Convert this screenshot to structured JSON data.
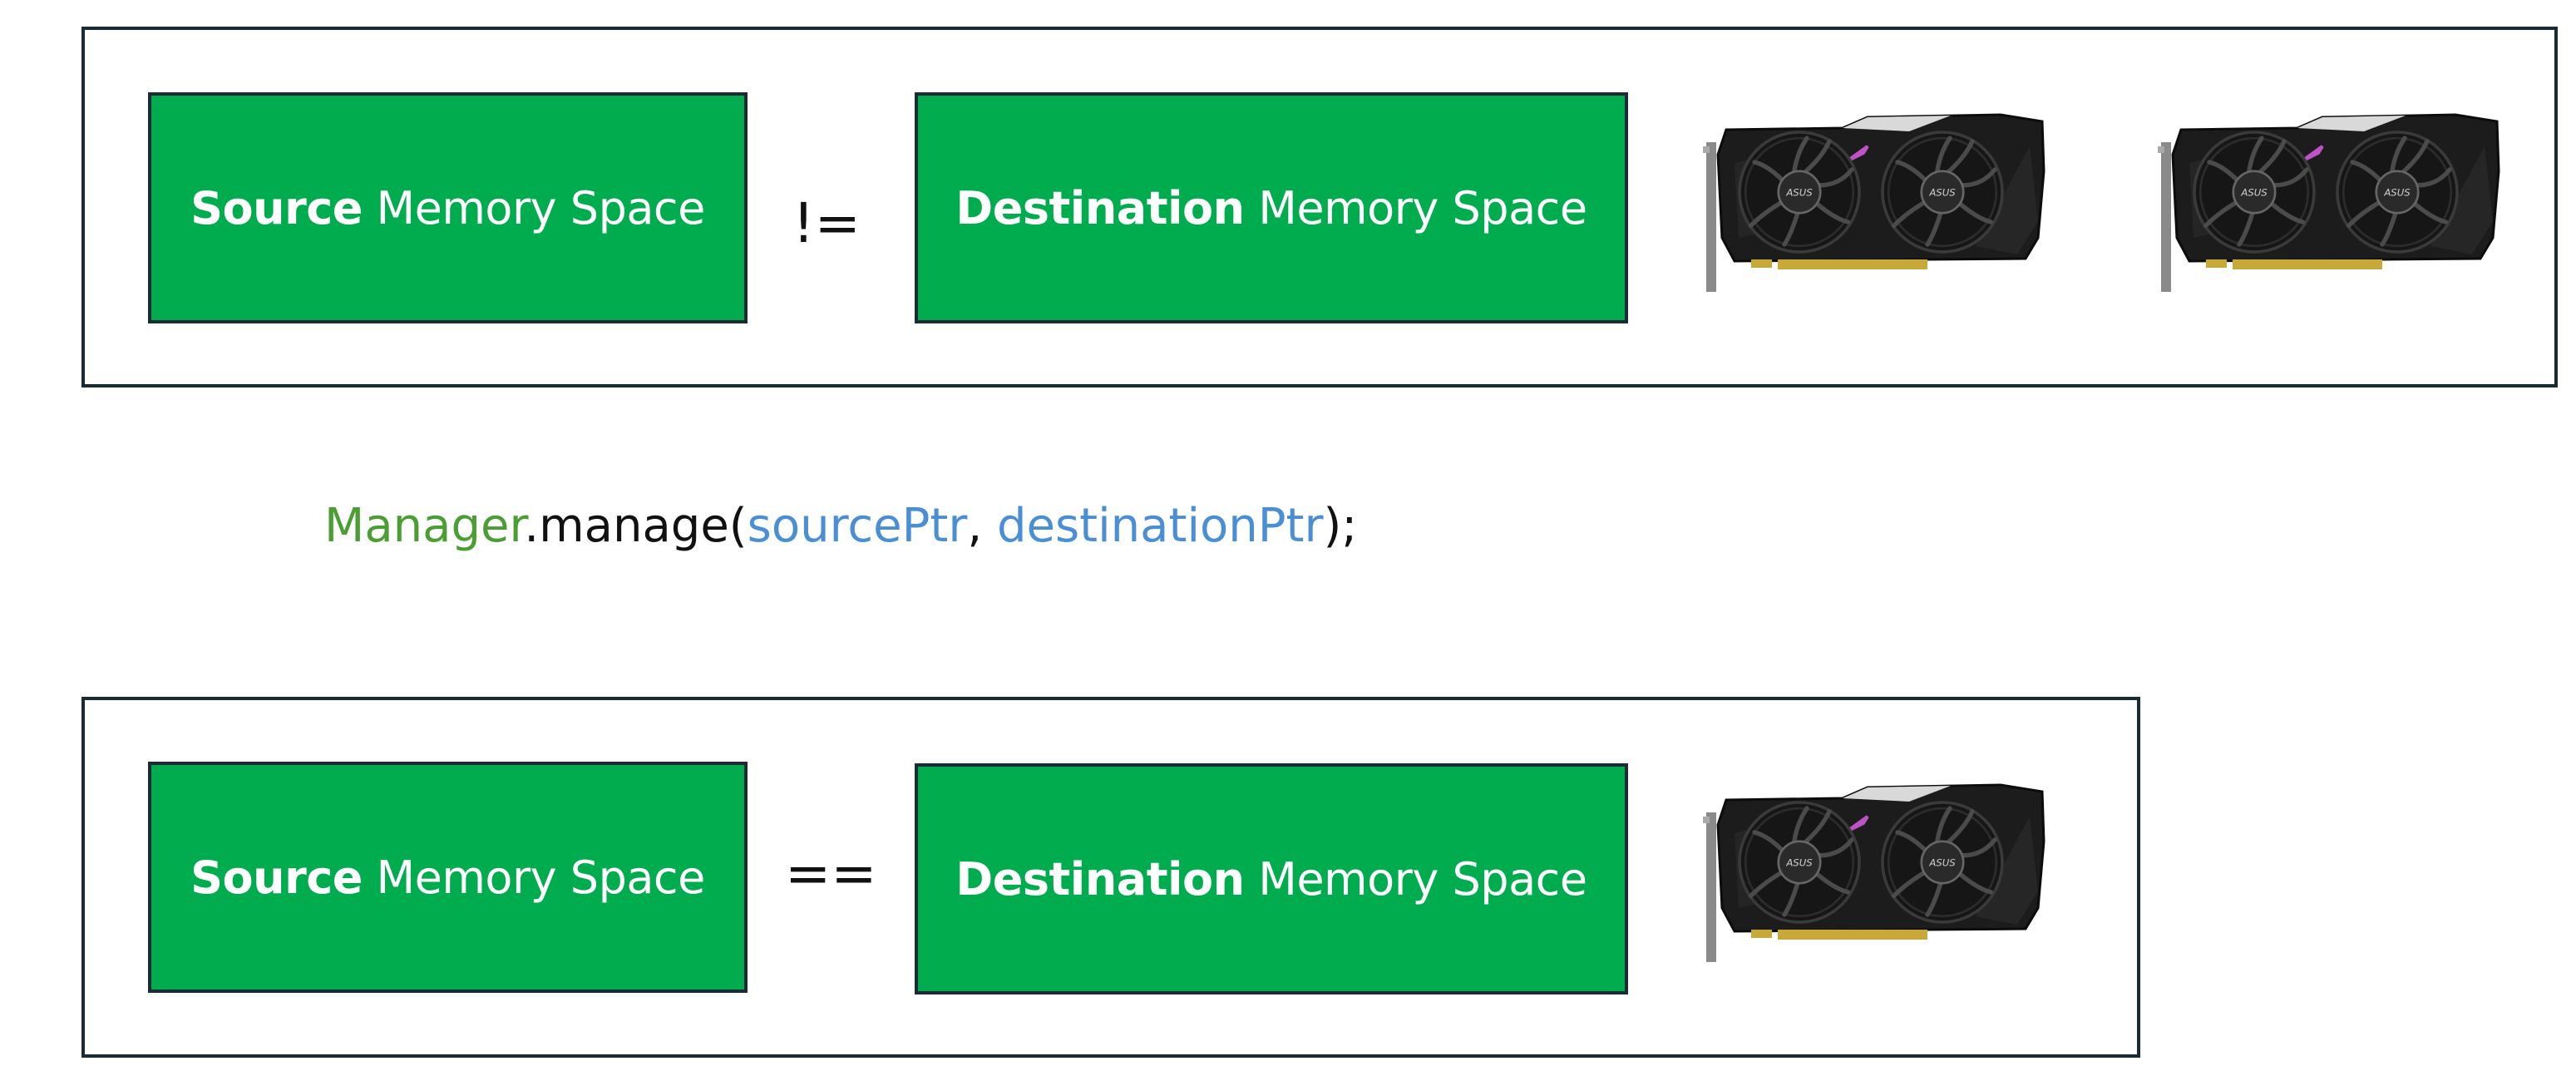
{
  "colors": {
    "box_fill": "#00ac4e",
    "box_border": "#1a2b35",
    "class_color": "#4a9e33",
    "variable_color": "#4a8fd6"
  },
  "top_panel": {
    "source_strong": "Source",
    "source_rest": " Memory Space",
    "operator": "!=",
    "destination_strong": "Destination",
    "destination_rest": " Memory Space",
    "gpu_count": 2
  },
  "code": {
    "class_name": "Manager",
    "method": ".manage(",
    "arg1": "sourcePtr",
    "sep": ", ",
    "arg2": "destinationPtr",
    "end": ");"
  },
  "bottom_panel": {
    "source_strong": "Source",
    "source_rest": " Memory Space",
    "operator": "==",
    "destination_strong": "Destination",
    "destination_rest": " Memory Space",
    "gpu_count": 1
  },
  "icons": {
    "gpu": "graphics-card-icon"
  }
}
